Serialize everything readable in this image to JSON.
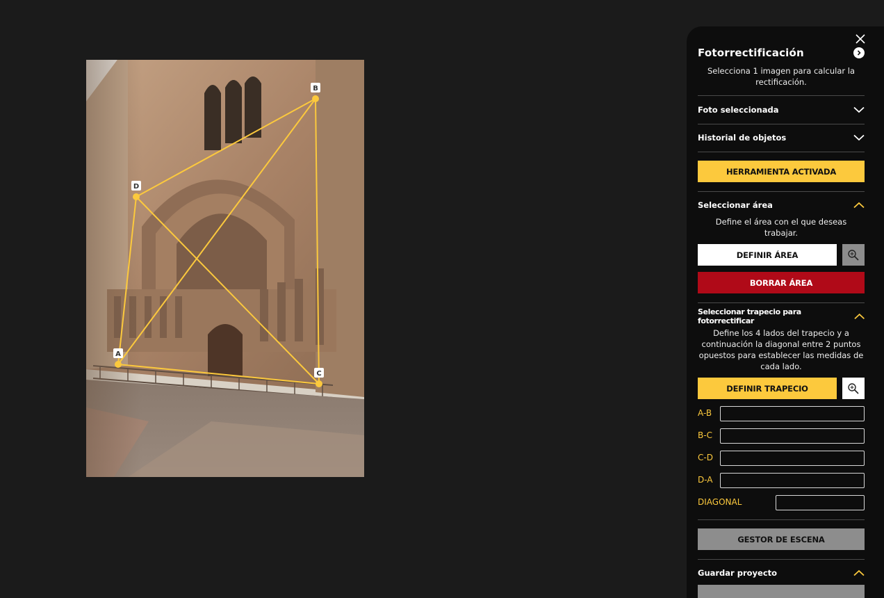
{
  "panel": {
    "title": "Fotorrectificación",
    "subtitle": "Selecciona 1 imagen para calcular la rectificación.",
    "sections": {
      "foto_seleccionada": "Foto seleccionada",
      "historial": "Historial de objetos",
      "seleccionar_area": "Seleccionar área",
      "seleccionar_trapecio": "Seleccionar trapecio para fotorrectificar",
      "guardar": "Guardar proyecto"
    },
    "tool_status_button": "HERRAMIENTA ACTIVADA",
    "area": {
      "description": "Define el área con el que deseas trabajar.",
      "define_button": "DEFINIR ÁREA",
      "delete_button": "BORRAR ÁREA"
    },
    "trapecio": {
      "description": "Define los 4 lados del trapecio y a continuación la diagonal entre 2 puntos opuestos para establecer las medidas de cada lado.",
      "define_button": "DEFINIR TRAPECIO",
      "measurements": [
        {
          "label": "A-B",
          "value": ""
        },
        {
          "label": "B-C",
          "value": ""
        },
        {
          "label": "C-D",
          "value": ""
        },
        {
          "label": "D-A",
          "value": ""
        },
        {
          "label": "DIAGONAL",
          "value": ""
        }
      ]
    },
    "scene_manager_button": "GESTOR DE ESCENA"
  },
  "trapezoid_points": {
    "labels": [
      "A",
      "B",
      "C",
      "D"
    ],
    "color": "#fcc93d"
  },
  "colors": {
    "accent": "#fcc93d",
    "danger": "#b00a18",
    "panel_bg": "#0d0d0d",
    "page_bg": "#1b1b1b"
  }
}
